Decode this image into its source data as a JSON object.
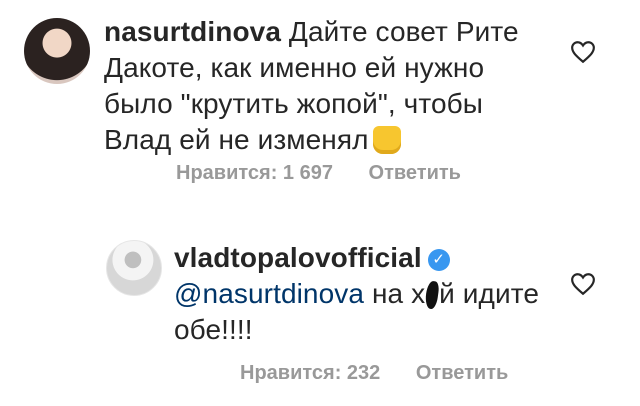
{
  "comments": [
    {
      "username": "nasurtdinova",
      "text": "Дайте совет Рите Дакоте, как именно ей нужно было \"крутить жопой\", чтобы Влад ей не изменял",
      "likes_label": "Нравится: 1 697",
      "reply_label": "Ответить",
      "emoji": "raised-fist"
    },
    {
      "username": "vladtopalovofficial",
      "verified": true,
      "mention": "@nasurtdinova",
      "text_before": "на х",
      "text_after": "й идите обе!!!!",
      "likes_label": "Нравится: 232",
      "reply_label": "Ответить"
    }
  ],
  "colors": {
    "text": "#262626",
    "meta": "#999999",
    "mention": "#003569",
    "verified": "#3897f0"
  }
}
